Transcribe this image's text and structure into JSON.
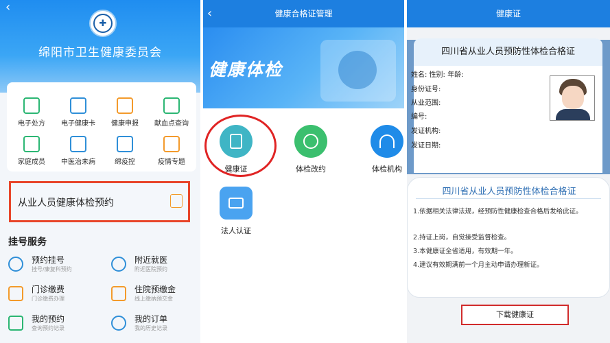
{
  "panel1": {
    "org_name": "绵阳市卫生健康委员会",
    "grid": [
      {
        "label": "电子处方"
      },
      {
        "label": "电子健康卡"
      },
      {
        "label": "健康申报"
      },
      {
        "label": "献血点查询"
      },
      {
        "label": "家庭成员"
      },
      {
        "label": "中医治未病"
      },
      {
        "label": "绵疫控"
      },
      {
        "label": "疫情专题"
      }
    ],
    "appointment_label": "从业人员健康体检预约",
    "section_title": "挂号服务",
    "services": [
      {
        "title": "预约挂号",
        "sub": "挂号/康复科预约"
      },
      {
        "title": "附近就医",
        "sub": "附近医院预约"
      },
      {
        "title": "门诊缴费",
        "sub": "门诊缴费办理"
      },
      {
        "title": "住院预缴金",
        "sub": "线上缴纳预交金"
      },
      {
        "title": "我的预约",
        "sub": "查询预约记录"
      },
      {
        "title": "我的订单",
        "sub": "我的历史记录"
      }
    ]
  },
  "panel2": {
    "title": "健康合格证管理",
    "banner_text": "健康体检",
    "functions": [
      {
        "label": "健康证",
        "color": "#3fb5c5"
      },
      {
        "label": "体检改约",
        "color": "#3bbf6e"
      },
      {
        "label": "体检机构",
        "color": "#1f8be8"
      },
      {
        "label": "法人认证",
        "color": "#4aa3f0"
      }
    ]
  },
  "panel3": {
    "title": "健康证",
    "cert_title": "四川省从业人员预防性体检合格证",
    "fields": [
      "姓名: 性别: 年龄:",
      "身份证号:",
      "从业范围:",
      "编号:",
      "发证机构:",
      "发证日期:"
    ],
    "notice_title": "四川省从业人员预防性体检合格证",
    "notices": [
      "1.依据相关法律法规，经预防性健康检查合格后发给此证。",
      "2.持证上岗，自觉接受监督检查。",
      "3.本健康证全省适用，有效期一年。",
      "4.建议有效期满前一个月主动申请办理新证。"
    ],
    "download_label": "下载健康证"
  }
}
